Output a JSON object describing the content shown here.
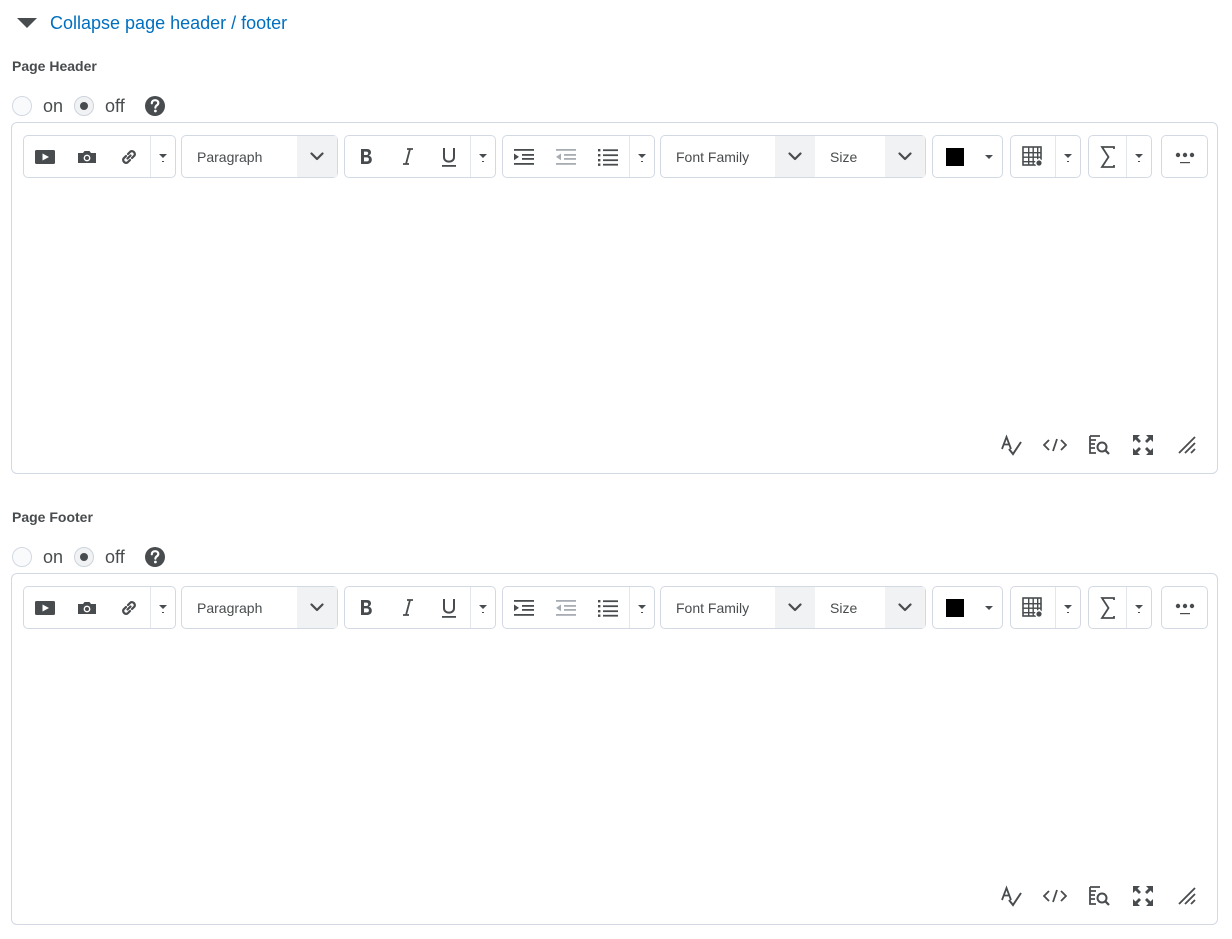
{
  "collapse": {
    "label": "Collapse page header / footer"
  },
  "sections": [
    {
      "key": "header",
      "label": "Page Header",
      "on_label": "on",
      "off_label": "off",
      "selected": "off"
    },
    {
      "key": "footer",
      "label": "Page Footer",
      "on_label": "on",
      "off_label": "off",
      "selected": "off"
    }
  ],
  "toolbar": {
    "format_select": "Paragraph",
    "font_family_select": "Font Family",
    "size_select": "Size",
    "text_color": "#000000"
  },
  "colors": {
    "link": "#006fbf",
    "text": "#494c4e",
    "border": "#d3d9e3"
  }
}
